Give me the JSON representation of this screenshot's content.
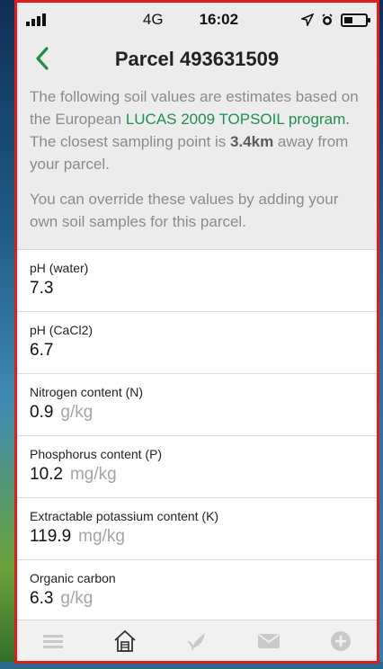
{
  "status": {
    "carrier_network": "4G",
    "time": "16:02"
  },
  "nav": {
    "title": "Parcel 493631509"
  },
  "info": {
    "p1_prefix": "The following soil values are estimates based on the European ",
    "p1_link": "LUCAS 2009 TOPSOIL program.",
    "p1_mid": " The closest sampling point is ",
    "p1_distance": "3.4km",
    "p1_suffix": " away from your parcel.",
    "p2": "You can override these values by adding your own soil samples for this parcel."
  },
  "soil": [
    {
      "label": "pH (water)",
      "value": "7.3",
      "unit": ""
    },
    {
      "label": "pH (CaCl2)",
      "value": "6.7",
      "unit": ""
    },
    {
      "label": "Nitrogen content (N)",
      "value": "0.9",
      "unit": "g/kg"
    },
    {
      "label": "Phosphorus content (P)",
      "value": "10.2",
      "unit": "mg/kg"
    },
    {
      "label": "Extractable potassium content (K)",
      "value": "119.9",
      "unit": "mg/kg"
    },
    {
      "label": "Organic carbon",
      "value": "6.3",
      "unit": "g/kg"
    }
  ],
  "tabs": [
    {
      "icon": "menu-icon"
    },
    {
      "icon": "home-icon"
    },
    {
      "icon": "sprout-icon"
    },
    {
      "icon": "mail-icon"
    },
    {
      "icon": "add-circle-icon"
    }
  ],
  "colors": {
    "accent": "#1f8f52",
    "frame": "#e21b1b"
  }
}
